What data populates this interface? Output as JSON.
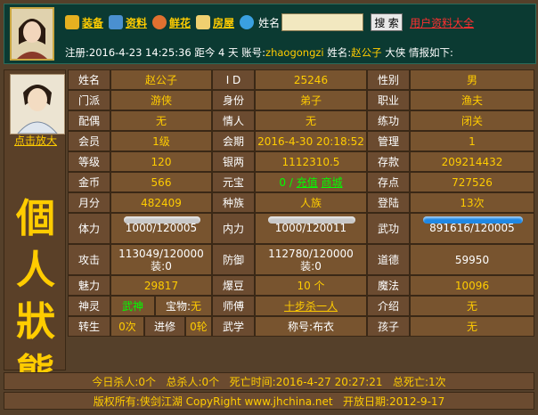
{
  "toolbar": {
    "equip": "装备",
    "profile": "资料",
    "flowers": "鲜花",
    "house": "房屋",
    "name_label": "姓名",
    "search_value": "",
    "search_button": "搜 索",
    "all_profiles": "用户资料大全"
  },
  "infoline": {
    "register_label": "注册:",
    "register_date": "2016-4-23 14:25:36",
    "days_label": "距今",
    "days": "4",
    "days_unit": "天",
    "account_label": "账号:",
    "account": "zhaogongzi",
    "name_label": "姓名:",
    "name": "赵公子",
    "title": "大侠",
    "suffix": "情报如下:"
  },
  "left": {
    "enlarge": "点击放大",
    "title": "個人狀態"
  },
  "stats": {
    "r1": [
      "姓名",
      "赵公子",
      "I D",
      "25246",
      "性别",
      "男"
    ],
    "r2": [
      "门派",
      "游侠",
      "身份",
      "弟子",
      "职业",
      "渔夫"
    ],
    "r3": [
      "配偶",
      "无",
      "情人",
      "无",
      "练功",
      "闭关"
    ],
    "r4": [
      "会员",
      "1级",
      "会期",
      "2016-4-30 20:18:52",
      "管理",
      "1"
    ],
    "r5": [
      "等级",
      "120",
      "银两",
      "1112310.5",
      "存款",
      "209214432"
    ],
    "r6": [
      "金币",
      "566",
      "元宝",
      "0",
      "存点",
      "727526"
    ],
    "r6_links": {
      "recharge": "充值",
      "mall": "商城"
    },
    "r7": [
      "月分",
      "482409",
      "种族",
      "人族",
      "登陆",
      "13次"
    ],
    "r8": [
      "体力",
      "1000/120005",
      "内力",
      "1000/120011",
      "武功",
      "891616/120005"
    ],
    "bars": {
      "hp_fill": 0.01,
      "mp_fill": 0.01,
      "wugong_fill": 1.0
    },
    "r9": [
      "攻击",
      "113049/120000",
      "装:0",
      "防御",
      "112780/120000",
      "装:0",
      "道德",
      "59950"
    ],
    "r10": [
      "魅力",
      "29817",
      "爆豆",
      "10 个",
      "魔法",
      "10096"
    ],
    "r11": [
      "神灵",
      "武神",
      "宝物:",
      "无",
      "师傅",
      "十步杀一人",
      "介绍",
      "无"
    ],
    "r12": [
      "转生",
      "0次",
      "进修",
      "0轮",
      "武学",
      "称号:",
      "布衣",
      "孩子",
      "无"
    ]
  },
  "footer": {
    "today_label": "今日杀人:",
    "today": "0个",
    "total_label": "总杀人:",
    "total": "0个",
    "death_label": "死亡时间:",
    "death_time": "2016-4-27 20:27:21",
    "death_total_label": "总死亡:",
    "death_total": "1次",
    "copyright": "版权所有:侠剑江湖 CopyRight www.jhchina.net",
    "open_label": "开放日期:",
    "open_date": "2012-9-17"
  },
  "colors": {
    "accent": "#ffcc00",
    "header_bg": "#0b3a32",
    "label_bg": "#6b4b30",
    "value_bg": "#78542f",
    "bar_blue": "#1e88e5",
    "bar_grey": "#c8c8c8"
  }
}
